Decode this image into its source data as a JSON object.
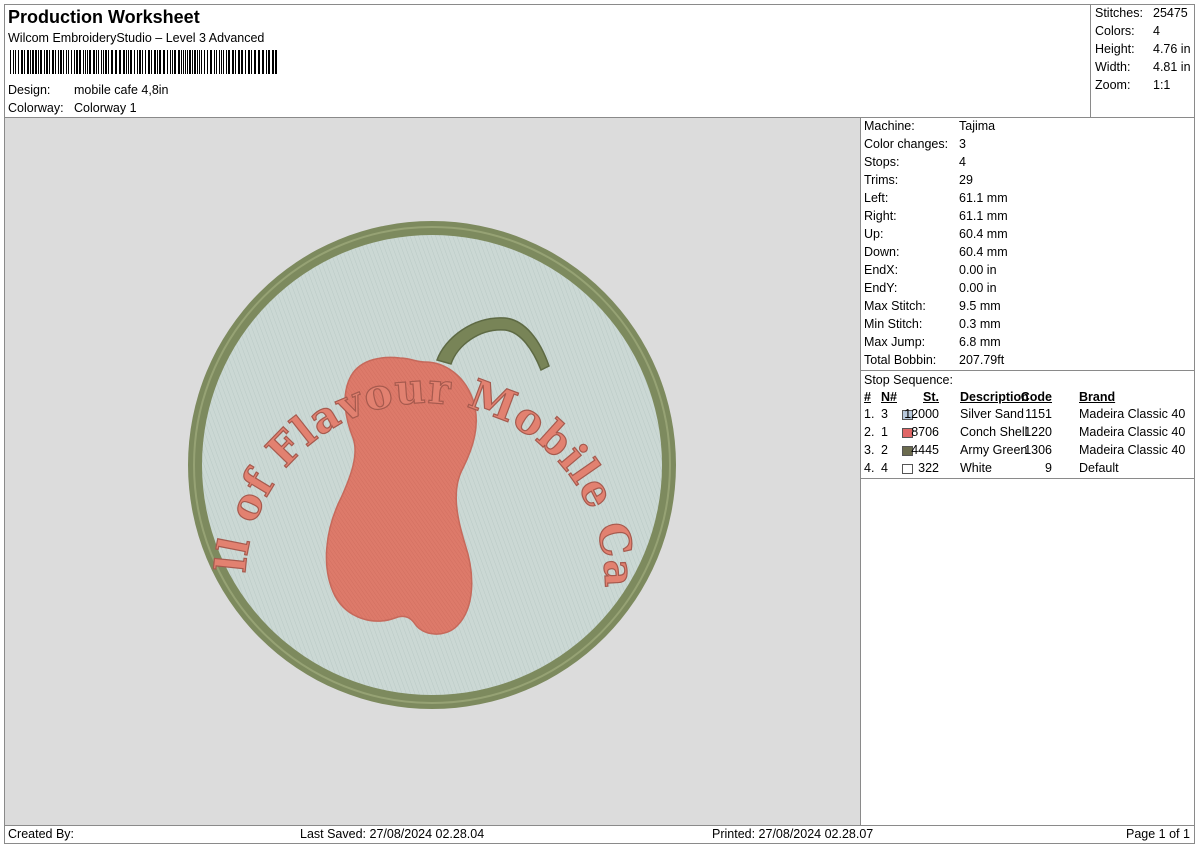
{
  "header": {
    "title": "Production Worksheet",
    "subtitle": "Wilcom EmbroideryStudio – Level 3 Advanced",
    "design_label": "Design:",
    "design_value": "mobile cafe 4,8in",
    "colorway_label": "Colorway:",
    "colorway_value": "Colorway 1"
  },
  "stats": [
    {
      "label": "Stitches:",
      "value": "25475"
    },
    {
      "label": "Colors:",
      "value": "4"
    },
    {
      "label": "Height:",
      "value": "4.76 in"
    },
    {
      "label": "Width:",
      "value": "4.81 in"
    },
    {
      "label": "Zoom:",
      "value": "1:1"
    }
  ],
  "machine_info": [
    {
      "label": "Machine:",
      "value": "Tajima"
    },
    {
      "label": "Color changes:",
      "value": "3"
    },
    {
      "label": "Stops:",
      "value": "4"
    },
    {
      "label": "Trims:",
      "value": "29"
    },
    {
      "label": "Left:",
      "value": "61.1 mm"
    },
    {
      "label": "Right:",
      "value": "61.1 mm"
    },
    {
      "label": "Up:",
      "value": "60.4 mm"
    },
    {
      "label": "Down:",
      "value": "60.4 mm"
    },
    {
      "label": "EndX:",
      "value": "0.00 in"
    },
    {
      "label": "EndY:",
      "value": "0.00 in"
    },
    {
      "label": "Max Stitch:",
      "value": "9.5 mm"
    },
    {
      "label": "Min Stitch:",
      "value": "0.3 mm"
    },
    {
      "label": "Max Jump:",
      "value": "6.8 mm"
    },
    {
      "label": "Total Bobbin:",
      "value": "207.79ft"
    }
  ],
  "stop_sequence": {
    "title": "Stop Sequence:",
    "headers": {
      "idx": "#",
      "n": "N#",
      "st": "St.",
      "desc": "Description",
      "code": "Code",
      "brand": "Brand"
    },
    "rows": [
      {
        "idx": "1.",
        "n": "3",
        "color": "#b8c9dc",
        "st": "12000",
        "desc": "Silver Sand",
        "code": "1151",
        "brand": "Madeira Classic 40"
      },
      {
        "idx": "2.",
        "n": "1",
        "color": "#e06666",
        "st": "8706",
        "desc": "Conch Shell",
        "code": "1220",
        "brand": "Madeira Classic 40"
      },
      {
        "idx": "3.",
        "n": "2",
        "color": "#6b6b4e",
        "st": "4445",
        "desc": "Army Green",
        "code": "1306",
        "brand": "Madeira Classic 40"
      },
      {
        "idx": "4.",
        "n": "4",
        "color": "#ffffff",
        "st": "322",
        "desc": "White",
        "code": "9",
        "brand": "Default"
      }
    ]
  },
  "design": {
    "arc_text": "Full of Flavour Mobile Cafe",
    "colors": {
      "fill": "#cbd8d4",
      "ring": "#7d8a5e",
      "pepper": "#dd7a6a",
      "stem": "#788457",
      "text": "#e28170",
      "text_shadow": "#a65a4e"
    }
  },
  "footer": {
    "created_by": "Created By:",
    "last_saved": "Last Saved: 27/08/2024 02.28.04",
    "printed": "Printed: 27/08/2024 02.28.07",
    "page": "Page 1 of 1"
  }
}
